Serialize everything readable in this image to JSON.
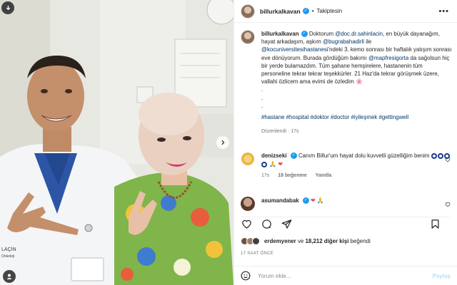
{
  "post": {
    "username": "billurkalkavan",
    "follow_status": "Takiptesin",
    "more_label": "•••",
    "caption": {
      "part1": "Doktorum ",
      "mention1": "@doc.dr.sahinlacin",
      "part2": ", en büyük dayanağım, hayat arkadaşım, aşkım ",
      "mention2": "@bugrabahadirli",
      "part3": " ile ",
      "mention3": "@kocuniversitesihastanesi",
      "part4": "'ndeki 3. kemo sonrası bir haftalık yatışım sonrası eve dönüyorum. Burada gördüğüm bakımı ",
      "mention4": "@mapfresigorta",
      "part5": " da sağolsun hiç bir yerde bulamazdım. Tüm şahane hemşirelere, hastanenin tüm personeline tekrar tekrar teşekkürler. 21 Haz'da tekrar görüşmek üzere, vallahi özlicem ama evimi de özledim 🌸",
      "dots": [
        ".",
        ".",
        "."
      ],
      "hashtags": "#hastane #hospital #doktor #doctor #iyileşmek #gettingwell",
      "edited": "Düzenlendi · 17s"
    },
    "comments": [
      {
        "user": "denizseki",
        "text": "Canım Billur'um hayat dolu kuvvetli güzelliğim benim",
        "emoji_tail": "🙏 ❤",
        "time": "17s",
        "likes": "18 beğenme",
        "reply": "Yanıtla"
      },
      {
        "user": "asumandabak",
        "text": "",
        "emoji_tail": "❤ 🙏"
      }
    ],
    "likes": {
      "first_user": "erdemyener",
      "connector": " ve ",
      "others": "18,212 diğer kişi",
      "tail": " beğendi"
    },
    "time_ago": "17 SAAT ÖNCE",
    "comment_placeholder": "Yorum ekle...",
    "post_button": "Paylaş"
  },
  "photo": {
    "coat_text_left": "LAÇİN",
    "coat_text_left2": "Onkoloji"
  },
  "icons": [
    "user-icon",
    "verified-badge-icon",
    "more-icon",
    "heart-icon",
    "comment-icon",
    "share-icon",
    "bookmark-icon",
    "emoji-icon",
    "next-arrow-icon",
    "tag-people-icon",
    "download-icon"
  ],
  "colors": {
    "link": "#00376b",
    "verified": "#1d9bf0",
    "muted": "#737373",
    "heart": "#ed4956"
  }
}
